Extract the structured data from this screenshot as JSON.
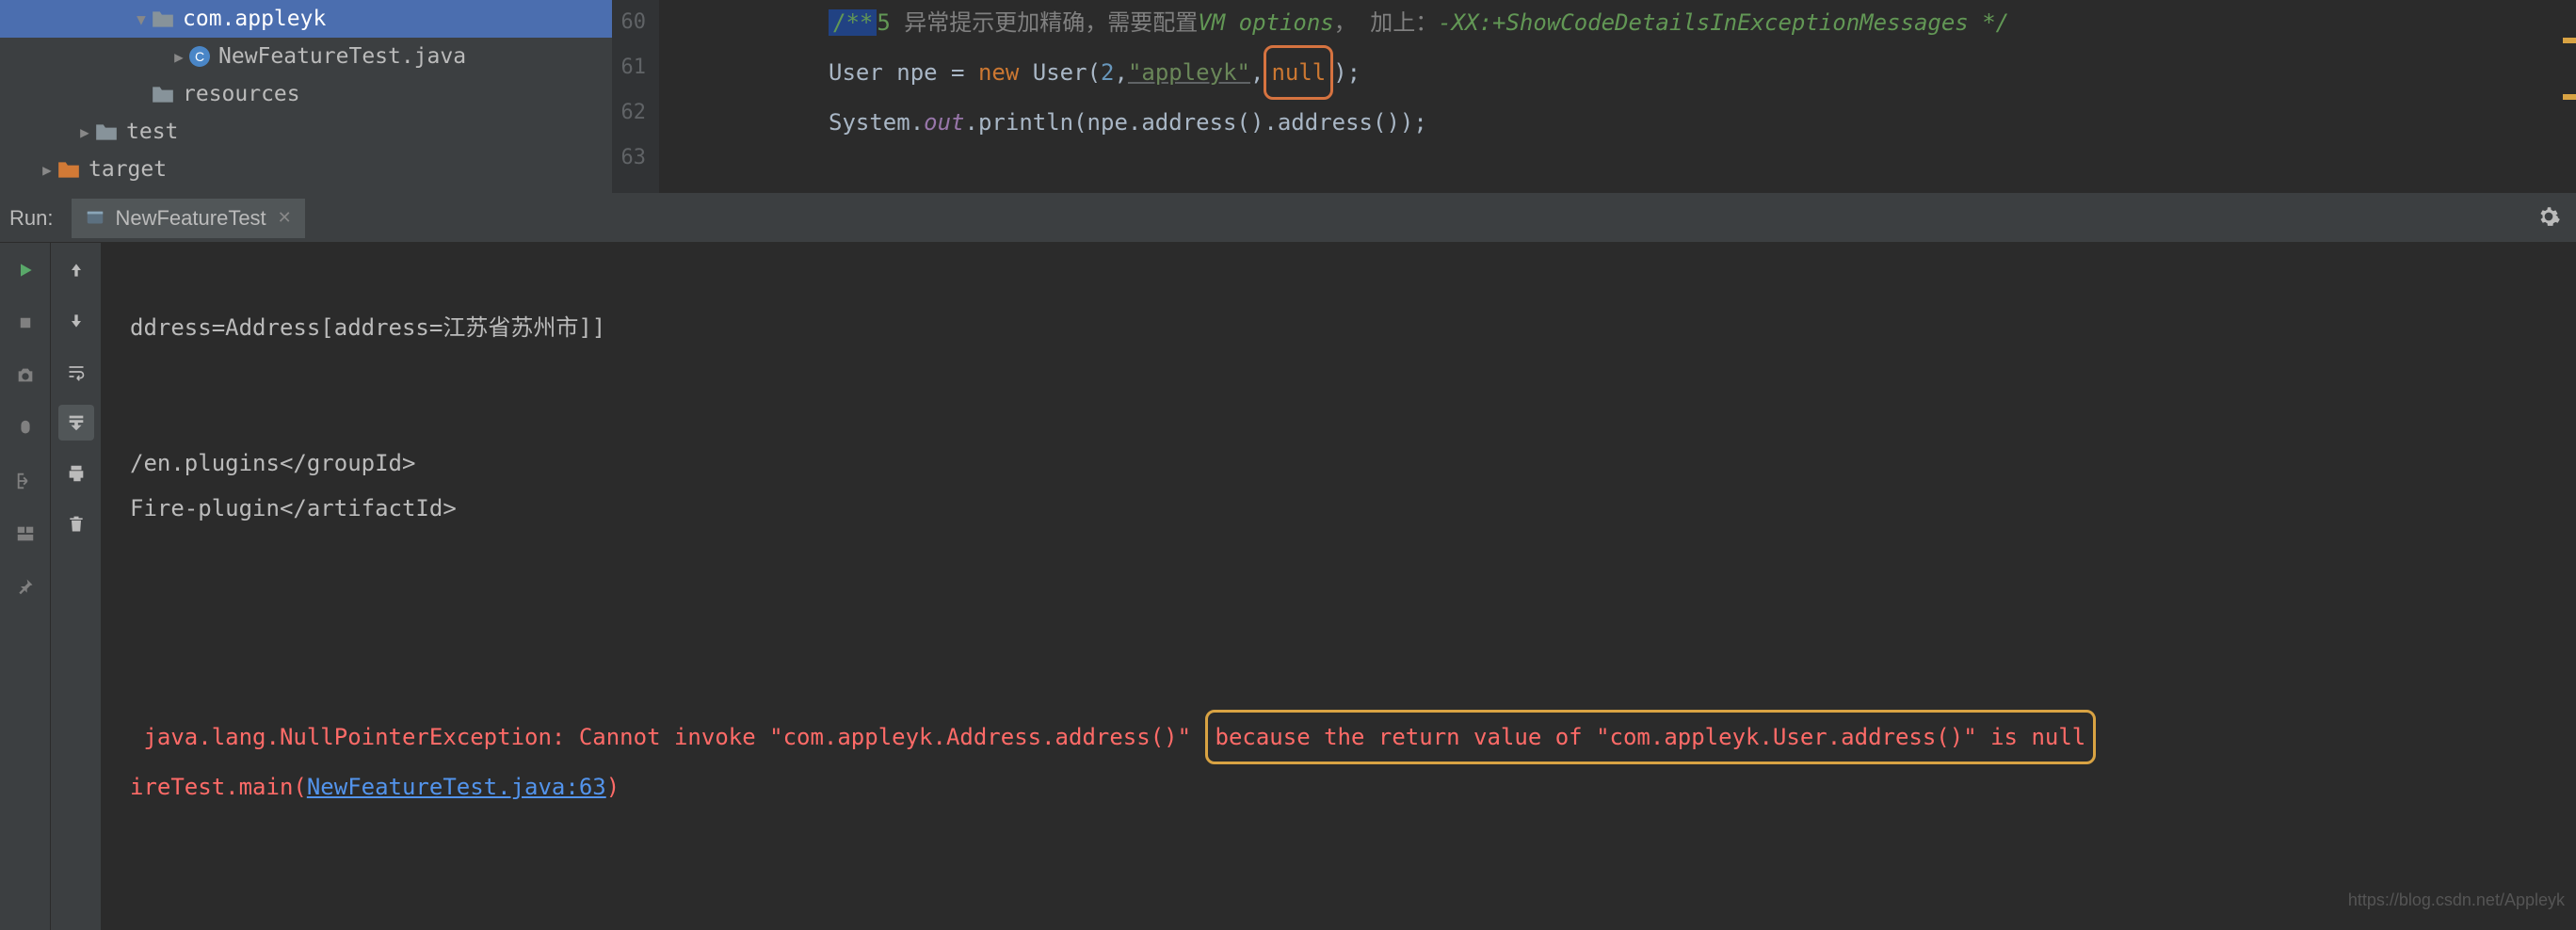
{
  "tree": {
    "items": [
      {
        "label": "com.appleyk",
        "indent": 140,
        "arrow": "▼",
        "icon": "folder",
        "selected": true
      },
      {
        "label": "NewFeatureTest.java",
        "indent": 180,
        "arrow": "▶",
        "icon": "java",
        "selected": false
      },
      {
        "label": "resources",
        "indent": 140,
        "arrow": "",
        "icon": "folder-gray",
        "selected": false
      },
      {
        "label": "test",
        "indent": 80,
        "arrow": "▶",
        "icon": "folder-gray",
        "selected": false
      },
      {
        "label": "target",
        "indent": 40,
        "arrow": "▶",
        "icon": "folder-orange",
        "selected": false
      }
    ]
  },
  "gutter": [
    "60",
    "61",
    "62",
    "63"
  ],
  "code": {
    "line60": "",
    "comment_prefix": "/**",
    "comment_num": "5",
    "comment_cn": " 异常提示更加精确，需要配置",
    "comment_vm": "VM options",
    "comment_cn2": "， 加上：",
    "comment_flag": "-XX:+ShowCodeDetailsInExceptionMessages */",
    "type_user": "User",
    "var_npe": "npe",
    "eq": " = ",
    "new_kw": "new",
    "ctor": "User",
    "arg_num": "2",
    "arg_str": "\"appleyk\"",
    "null_kw": "null",
    "tail62": ");",
    "sys": "System.",
    "out": "out",
    "println": ".println(npe.address().address());"
  },
  "run": {
    "label": "Run:",
    "tab_name": "NewFeatureTest"
  },
  "console": {
    "line1": "ddress=Address[address=江苏省苏州市]]",
    "line3a": "/en.plugins</groupId>",
    "line3b": "Fire-plugin</artifactId>",
    "err_pre": " java.lang.NullPointerException: Cannot invoke \"com.appleyk.Address.address()\"",
    "err_box": "because the return value of \"com.appleyk.User.address()\" is null",
    "err2_pre": "ireTest.main(",
    "err2_link": "NewFeatureTest.java:63",
    "err2_post": ")"
  },
  "watermark": "https://blog.csdn.net/Appleyk"
}
